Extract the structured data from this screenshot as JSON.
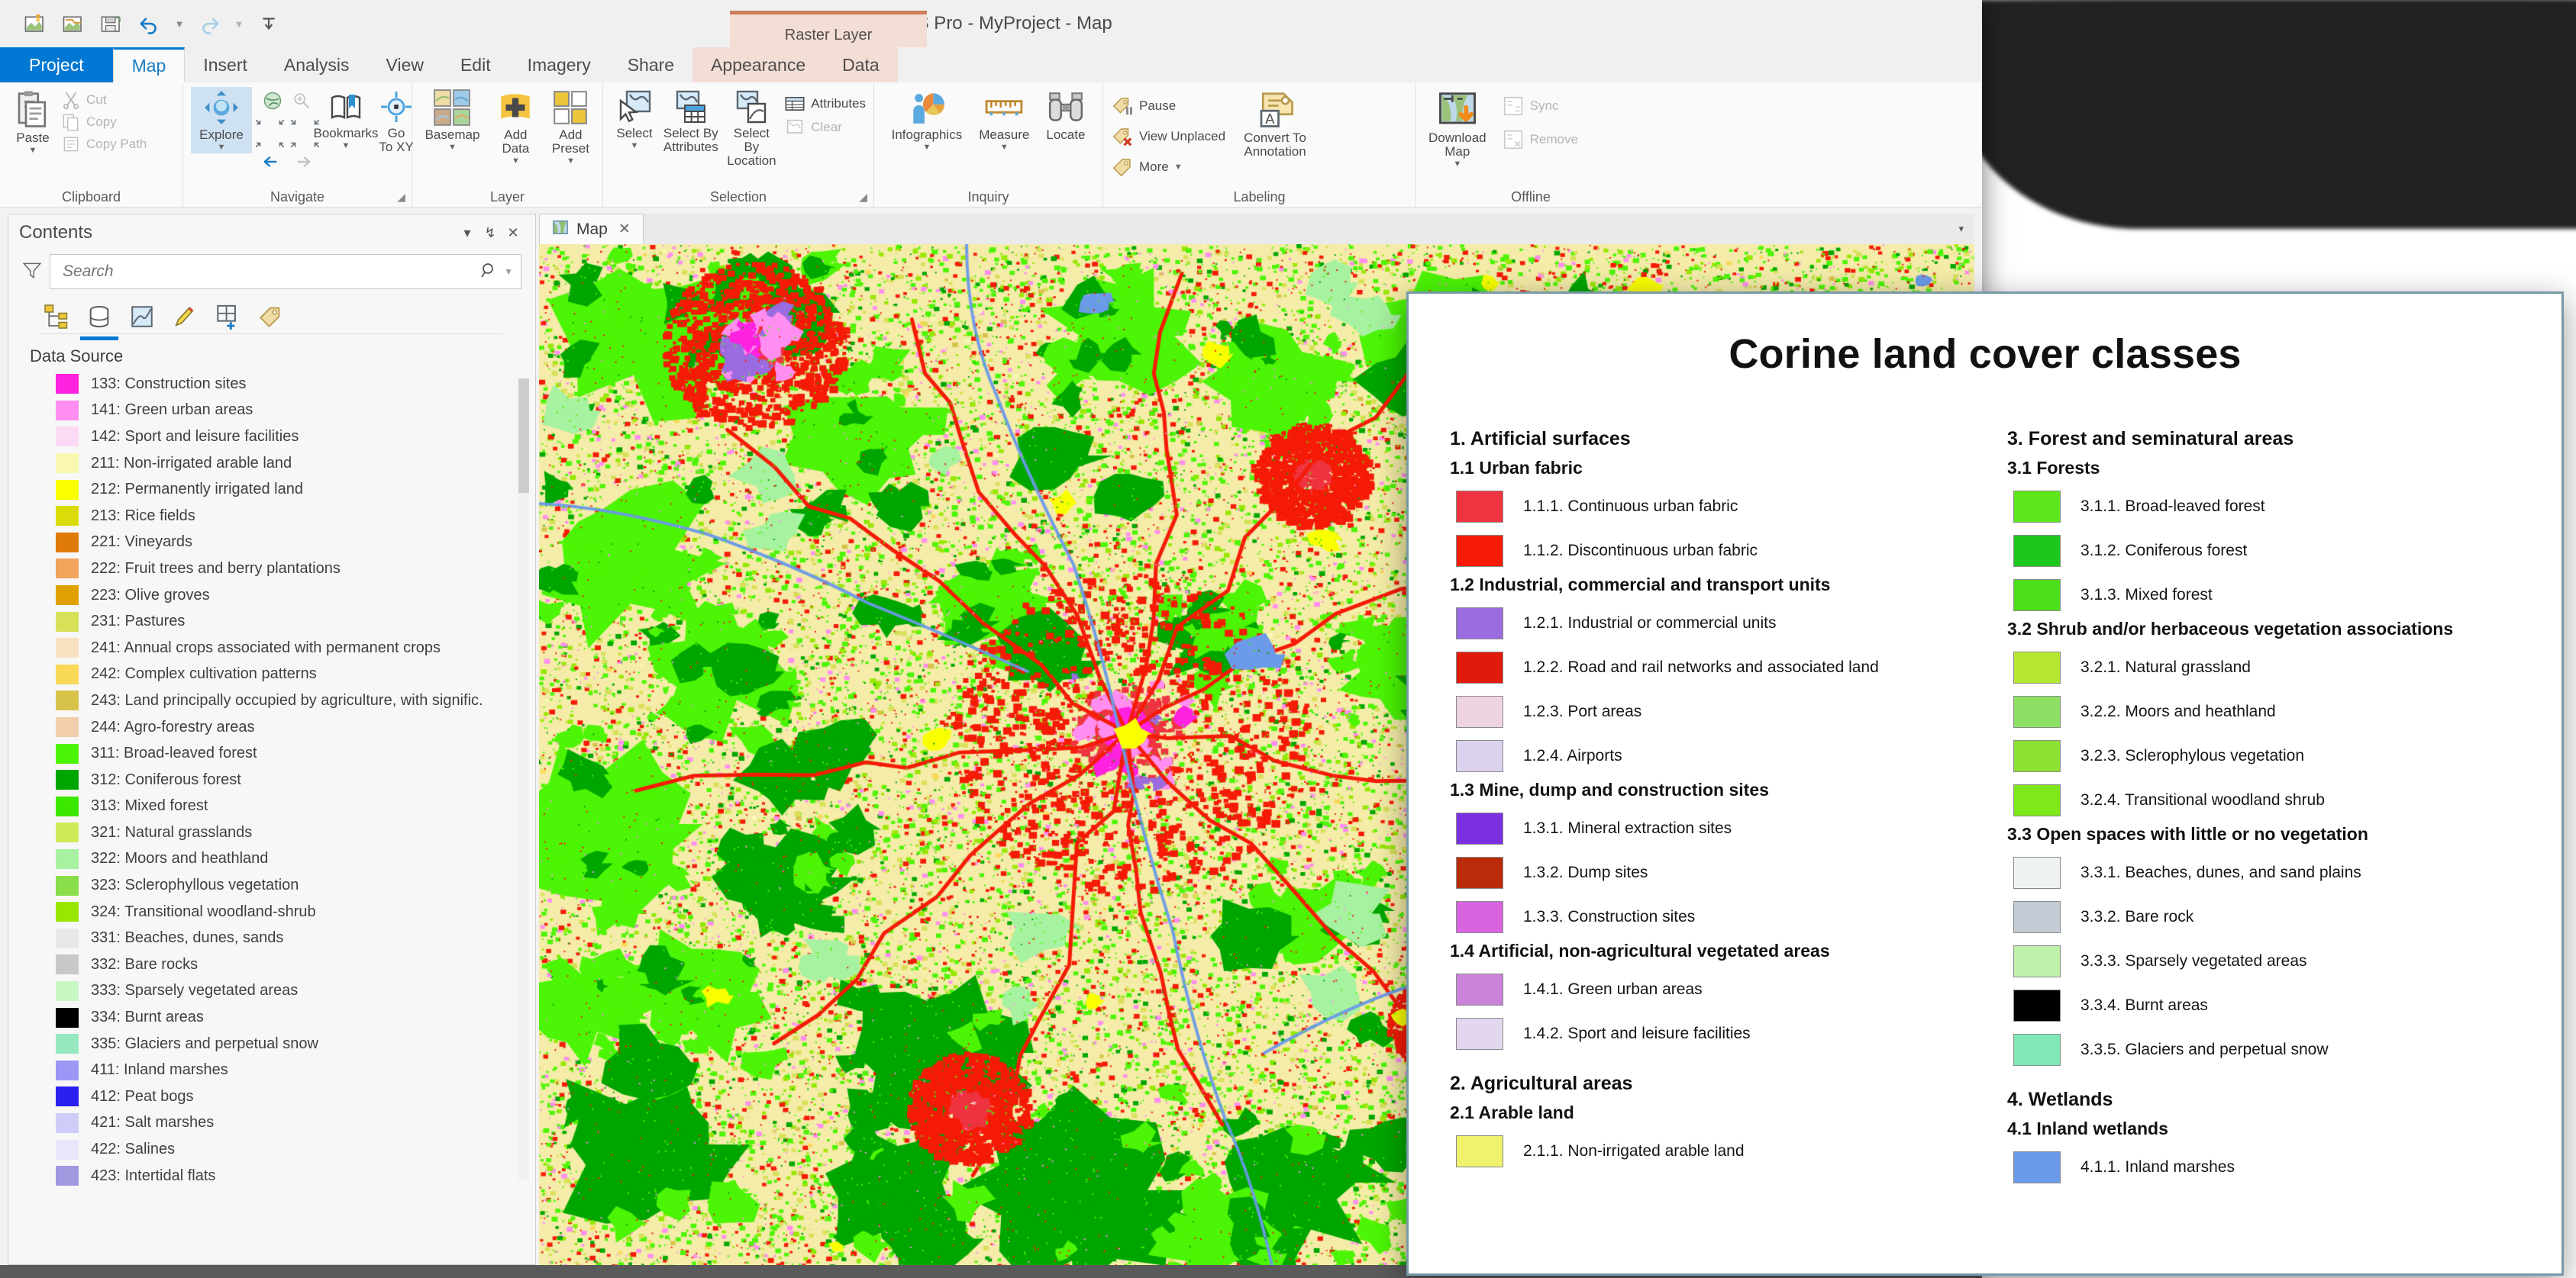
{
  "window": {
    "title": "ArcGIS Pro - MyProject - Map"
  },
  "quick_access": {
    "items": [
      {
        "name": "new-project-icon",
        "label": "New Project"
      },
      {
        "name": "open-project-icon",
        "label": "Open Project"
      },
      {
        "name": "save-project-icon",
        "label": "Save Project"
      },
      {
        "name": "undo-icon",
        "label": "Undo"
      },
      {
        "name": "redo-icon",
        "label": "Redo"
      },
      {
        "name": "customize-quick-access-icon",
        "label": "Customize Quick Access Toolbar"
      }
    ]
  },
  "ribbon": {
    "contextual_group": "Raster Layer",
    "tabs": [
      {
        "label": "Project",
        "state": "backstage"
      },
      {
        "label": "Map",
        "state": "active"
      },
      {
        "label": "Insert",
        "state": "normal"
      },
      {
        "label": "Analysis",
        "state": "normal"
      },
      {
        "label": "View",
        "state": "normal"
      },
      {
        "label": "Edit",
        "state": "normal"
      },
      {
        "label": "Imagery",
        "state": "normal"
      },
      {
        "label": "Share",
        "state": "normal"
      },
      {
        "label": "Appearance",
        "state": "contextual"
      },
      {
        "label": "Data",
        "state": "contextual"
      }
    ],
    "groups": [
      {
        "label": "Clipboard",
        "has_launcher": false,
        "big": [
          {
            "label": "Paste",
            "icon": "paste-icon",
            "dropdown": true,
            "selected": false
          }
        ],
        "small": [
          {
            "label": "Cut",
            "icon": "cut-icon",
            "disabled": true
          },
          {
            "label": "Copy",
            "icon": "copy-icon",
            "disabled": true
          },
          {
            "label": "Copy Path",
            "icon": "copy-path-icon",
            "disabled": true
          }
        ]
      },
      {
        "label": "Navigate",
        "has_launcher": true,
        "big": [
          {
            "label": "Explore",
            "icon": "explore-icon",
            "dropdown": true,
            "selected": true
          },
          {
            "label": "Bookmarks",
            "icon": "bookmarks-icon",
            "dropdown": true,
            "selected": false
          },
          {
            "label": "Go\nTo XY",
            "icon": "go-to-xy-icon",
            "dropdown": false,
            "selected": false
          }
        ],
        "small": []
      },
      {
        "label": "Layer",
        "has_launcher": false,
        "big": [
          {
            "label": "Basemap",
            "icon": "basemap-icon",
            "dropdown": true,
            "selected": false
          },
          {
            "label": "Add\nData",
            "icon": "add-data-icon",
            "dropdown": true,
            "selected": false
          },
          {
            "label": "Add\nPreset",
            "icon": "add-preset-icon",
            "dropdown": true,
            "selected": false
          }
        ],
        "small": []
      },
      {
        "label": "Selection",
        "has_launcher": true,
        "big": [
          {
            "label": "Select",
            "icon": "select-icon",
            "dropdown": true,
            "selected": false
          },
          {
            "label": "Select By\nAttributes",
            "icon": "select-by-attributes-icon",
            "dropdown": false,
            "selected": false
          },
          {
            "label": "Select By\nLocation",
            "icon": "select-by-location-icon",
            "dropdown": false,
            "selected": false
          }
        ],
        "small": [
          {
            "label": "Attributes",
            "icon": "attributes-icon",
            "disabled": false
          },
          {
            "label": "Clear",
            "icon": "clear-selection-icon",
            "disabled": true
          }
        ]
      },
      {
        "label": "Inquiry",
        "has_launcher": false,
        "big": [
          {
            "label": "Infographics",
            "icon": "infographics-icon",
            "dropdown": true,
            "selected": false
          },
          {
            "label": "Measure",
            "icon": "measure-icon",
            "dropdown": true,
            "selected": false
          },
          {
            "label": "Locate",
            "icon": "locate-icon",
            "dropdown": false,
            "selected": false
          }
        ],
        "small": []
      },
      {
        "label": "Labeling",
        "has_launcher": false,
        "big": [],
        "small": [
          {
            "label": "Pause",
            "icon": "pause-labels-icon",
            "disabled": false
          },
          {
            "label": "View Unplaced",
            "icon": "view-unplaced-labels-icon",
            "disabled": false
          },
          {
            "label": "More",
            "icon": "more-labeling-icon",
            "disabled": false,
            "dropdown": true
          }
        ],
        "big2": [
          {
            "label": "Convert To\nAnnotation",
            "icon": "convert-to-annotation-icon",
            "dropdown": false,
            "selected": false
          }
        ]
      },
      {
        "label": "Offline",
        "has_launcher": false,
        "big": [
          {
            "label": "Download\nMap",
            "icon": "download-map-icon",
            "dropdown": true,
            "selected": false
          }
        ],
        "small": [
          {
            "label": "Sync",
            "icon": "sync-icon",
            "disabled": true
          },
          {
            "label": "Remove",
            "icon": "remove-offline-icon",
            "disabled": true
          }
        ]
      }
    ]
  },
  "contents_pane": {
    "title": "Contents",
    "header_buttons": [
      {
        "name": "pane-menu-icon",
        "glyph": "▾"
      },
      {
        "name": "pin-pane-icon",
        "glyph": "↯"
      },
      {
        "name": "close-pane-icon",
        "glyph": "✕"
      }
    ],
    "search": {
      "placeholder": "Search",
      "value": ""
    },
    "tab_icons": [
      {
        "name": "list-by-drawing-order-icon",
        "active": false
      },
      {
        "name": "list-by-data-source-icon",
        "active": true
      },
      {
        "name": "list-by-selection-icon",
        "active": false
      },
      {
        "name": "list-by-editing-icon",
        "active": false
      },
      {
        "name": "list-by-snapping-icon",
        "active": false
      },
      {
        "name": "list-by-labeling-icon",
        "active": false
      }
    ],
    "group_label": "Data Source",
    "legend": [
      {
        "code": "133",
        "label": "133: Construction sites",
        "color": "#ff22e0"
      },
      {
        "code": "141",
        "label": "141: Green urban areas",
        "color": "#ff8ef0"
      },
      {
        "code": "142",
        "label": "142: Sport and leisure facilities",
        "color": "#fcd9f5"
      },
      {
        "code": "211",
        "label": "211: Non-irrigated arable land",
        "color": "#f8f8b0"
      },
      {
        "code": "212",
        "label": "212: Permanently irrigated land",
        "color": "#faff00"
      },
      {
        "code": "213",
        "label": "213: Rice fields",
        "color": "#dbdb0a"
      },
      {
        "code": "221",
        "label": "221: Vineyards",
        "color": "#e07b0b"
      },
      {
        "code": "222",
        "label": "222: Fruit trees and berry plantations",
        "color": "#f2a35c"
      },
      {
        "code": "223",
        "label": "223: Olive groves",
        "color": "#e0a000"
      },
      {
        "code": "231",
        "label": "231: Pastures",
        "color": "#d7e057"
      },
      {
        "code": "241",
        "label": "241: Annual crops associated with permanent crops",
        "color": "#fae2c0"
      },
      {
        "code": "242",
        "label": "242: Complex cultivation patterns",
        "color": "#fad858"
      },
      {
        "code": "243",
        "label": "243: Land principally occupied by agriculture, with signific.",
        "color": "#d7c34a"
      },
      {
        "code": "244",
        "label": "244: Agro-forestry areas",
        "color": "#f3ceab"
      },
      {
        "code": "311",
        "label": "311: Broad-leaved forest",
        "color": "#4cf505"
      },
      {
        "code": "312",
        "label": "312: Coniferous forest",
        "color": "#00a600"
      },
      {
        "code": "313",
        "label": "313: Mixed forest",
        "color": "#3ce800"
      },
      {
        "code": "321",
        "label": "321: Natural grasslands",
        "color": "#cdeb56"
      },
      {
        "code": "322",
        "label": "322: Moors and heathland",
        "color": "#a6f2a0"
      },
      {
        "code": "323",
        "label": "323: Sclerophyllous vegetation",
        "color": "#8ade4a"
      },
      {
        "code": "324",
        "label": "324: Transitional woodland-shrub",
        "color": "#97e700"
      },
      {
        "code": "331",
        "label": "331: Beaches, dunes, sands",
        "color": "#e8e8e8"
      },
      {
        "code": "332",
        "label": "332: Bare rocks",
        "color": "#c8c8c8"
      },
      {
        "code": "333",
        "label": "333: Sparsely vegetated areas",
        "color": "#c8f7c4"
      },
      {
        "code": "334",
        "label": "334: Burnt areas",
        "color": "#000000"
      },
      {
        "code": "335",
        "label": "335: Glaciers and perpetual snow",
        "color": "#95e8c0"
      },
      {
        "code": "411",
        "label": "411: Inland marshes",
        "color": "#9c96f5"
      },
      {
        "code": "412",
        "label": "412: Peat bogs",
        "color": "#2a20f0"
      },
      {
        "code": "421",
        "label": "421: Salt marshes",
        "color": "#cfcdf7"
      },
      {
        "code": "422",
        "label": "422: Salines",
        "color": "#e8e6fb"
      },
      {
        "code": "423",
        "label": "423: Intertidal flats",
        "color": "#9f99e0"
      }
    ]
  },
  "map_view": {
    "tab_label": "Map",
    "tab_close_glyph": "✕",
    "tab_icon": "map-tab-icon",
    "overflow_glyph": "▾"
  },
  "corine_poster": {
    "title": "Corine land cover classes",
    "columns": [
      {
        "blocks": [
          {
            "type": "lvl1",
            "text": "1. Artificial surfaces"
          },
          {
            "type": "lvl2",
            "text": "1.1 Urban fabric"
          },
          {
            "type": "item",
            "color": "#ef3340",
            "text": "1.1.1. Continuous urban fabric"
          },
          {
            "type": "item",
            "color": "#f51b07",
            "text": "1.1.2. Discontinuous urban fabric"
          },
          {
            "type": "lvl2",
            "text": "1.2 Industrial, commercial and transport units"
          },
          {
            "type": "item",
            "color": "#9b6ce0",
            "text": "1.2.1. Industrial or commercial units"
          },
          {
            "type": "item",
            "color": "#e01b0c",
            "text": "1.2.2. Road and rail networks and associated land"
          },
          {
            "type": "item",
            "color": "#eed3e2",
            "text": "1.2.3. Port areas"
          },
          {
            "type": "item",
            "color": "#dcd2ee",
            "text": "1.2.4. Airports"
          },
          {
            "type": "lvl2",
            "text": "1.3 Mine, dump and construction sites"
          },
          {
            "type": "item",
            "color": "#7b2fe0",
            "text": "1.3.1. Mineral extraction sites"
          },
          {
            "type": "item",
            "color": "#b92b09",
            "text": "1.3.2. Dump sites"
          },
          {
            "type": "item",
            "color": "#d964df",
            "text": "1.3.3. Construction sites"
          },
          {
            "type": "lvl2",
            "text": "1.4 Artificial, non-agricultural vegetated areas"
          },
          {
            "type": "item",
            "color": "#c983d8",
            "text": "1.4.1. Green urban areas"
          },
          {
            "type": "item",
            "color": "#e3d6ef",
            "text": "1.4.2. Sport and leisure facilities"
          },
          {
            "type": "lvl1",
            "text": "2. Agricultural areas"
          },
          {
            "type": "lvl2",
            "text": "2.1 Arable land"
          },
          {
            "type": "item",
            "color": "#eff26a",
            "text": "2.1.1. Non-irrigated arable land"
          }
        ]
      },
      {
        "blocks": [
          {
            "type": "lvl1",
            "text": "3. Forest and seminatural areas"
          },
          {
            "type": "lvl2",
            "text": "3.1 Forests"
          },
          {
            "type": "item",
            "color": "#5ce81b",
            "text": "3.1.1. Broad-leaved forest"
          },
          {
            "type": "item",
            "color": "#1dc71d",
            "text": "3.1.2. Coniferous forest"
          },
          {
            "type": "item",
            "color": "#4ce01b",
            "text": "3.1.3. Mixed forest"
          },
          {
            "type": "lvl2",
            "text": "3.2 Shrub and/or herbaceous vegetation associations"
          },
          {
            "type": "item",
            "color": "#b6e833",
            "text": "3.2.1. Natural grassland"
          },
          {
            "type": "item",
            "color": "#8de063",
            "text": "3.2.2. Moors and heathland"
          },
          {
            "type": "item",
            "color": "#8ce032",
            "text": "3.2.3. Sclerophylous vegetation"
          },
          {
            "type": "item",
            "color": "#7fe81b",
            "text": "3.2.4. Transitional woodland shrub"
          },
          {
            "type": "lvl2",
            "text": "3.3 Open spaces with little or no vegetation"
          },
          {
            "type": "item",
            "color": "#eef2f3",
            "text": "3.3.1. Beaches, dunes, and sand plains"
          },
          {
            "type": "item",
            "color": "#c3ccd4",
            "text": "3.3.2. Bare rock"
          },
          {
            "type": "item",
            "color": "#bdf0a8",
            "text": "3.3.3. Sparsely vegetated areas"
          },
          {
            "type": "item",
            "color": "#000000",
            "text": "3.3.4. Burnt areas"
          },
          {
            "type": "item",
            "color": "#7fe8b5",
            "text": "3.3.5. Glaciers and perpetual snow"
          },
          {
            "type": "lvl1",
            "text": "4. Wetlands"
          },
          {
            "type": "lvl2",
            "text": "4.1 Inland wetlands"
          },
          {
            "type": "item",
            "color": "#6a9ae8",
            "text": "4.1.1. Inland marshes"
          }
        ]
      }
    ]
  }
}
